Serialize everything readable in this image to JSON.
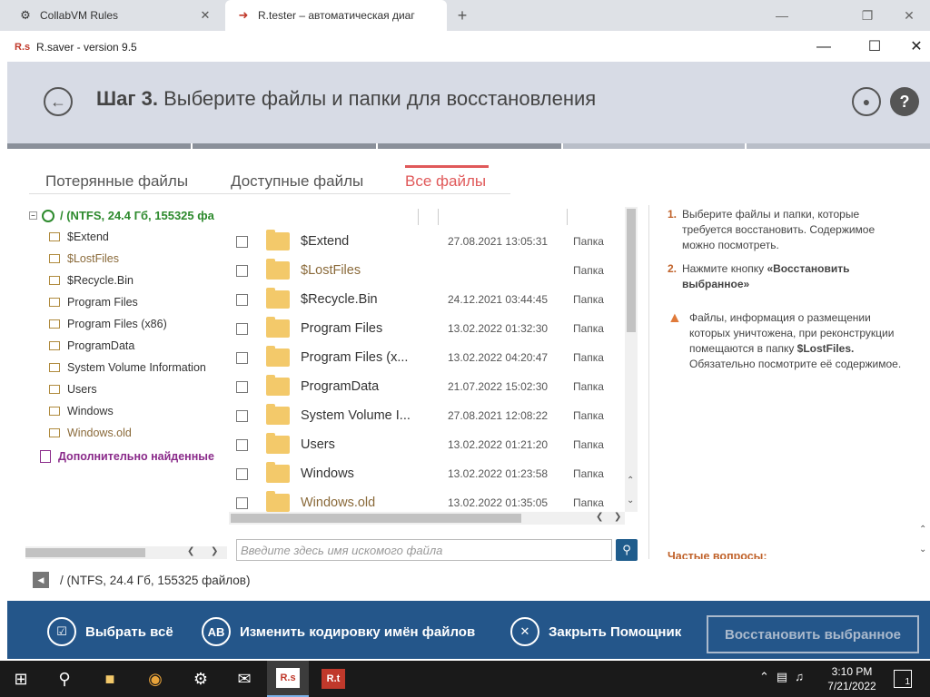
{
  "browser": {
    "tabs": [
      {
        "title": "CollabVM Rules",
        "icon": "collabvm-icon"
      },
      {
        "title": "R.tester – автоматическая диаг",
        "icon": "rtester-icon"
      }
    ]
  },
  "app": {
    "logo": "R.s",
    "title": "R.saver - version 9.5"
  },
  "header": {
    "step_label": "Шаг 3.",
    "step_text": "Выберите файлы и папки для восстановления"
  },
  "view_tabs": [
    {
      "label": "Потерянные файлы",
      "active": false
    },
    {
      "label": "Доступные файлы",
      "active": false
    },
    {
      "label": "Все файлы",
      "active": true
    }
  ],
  "tree": {
    "root": "/ (NTFS, 24.4 Гб, 155325 фа",
    "nodes": [
      "$Extend",
      "$LostFiles",
      "$Recycle.Bin",
      "Program Files",
      "Program Files (x86)",
      "ProgramData",
      "System Volume Information",
      "Users",
      "Windows",
      "Windows.old"
    ],
    "extra": "Дополнительно найденные"
  },
  "files": [
    {
      "name": "$Extend",
      "date": "27.08.2021 13:05:31",
      "type": "Папка"
    },
    {
      "name": "$LostFiles",
      "date": "",
      "type": "Папка"
    },
    {
      "name": "$Recycle.Bin",
      "date": "24.12.2021 03:44:45",
      "type": "Папка"
    },
    {
      "name": "Program Files",
      "date": "13.02.2022 01:32:30",
      "type": "Папка"
    },
    {
      "name": "Program Files (x...",
      "date": "13.02.2022 04:20:47",
      "type": "Папка"
    },
    {
      "name": "ProgramData",
      "date": "21.07.2022 15:02:30",
      "type": "Папка"
    },
    {
      "name": "System Volume I...",
      "date": "27.08.2021 12:08:22",
      "type": "Папка"
    },
    {
      "name": "Users",
      "date": "13.02.2022 01:21:20",
      "type": "Папка"
    },
    {
      "name": "Windows",
      "date": "13.02.2022 01:23:58",
      "type": "Папка"
    },
    {
      "name": "Windows.old",
      "date": "13.02.2022 01:35:05",
      "type": "Папка"
    }
  ],
  "search": {
    "placeholder": "Введите здесь имя искомого файла"
  },
  "help": {
    "item1_num": "1.",
    "item1_text": "Выберите файлы и папки, которые требуется восстановить. Содержимое можно посмотреть.",
    "item2_num": "2.",
    "item2_text_pre": "Нажмите кнопку ",
    "item2_text_bold": "«Восстановить выбранное»",
    "warning_pre": "Файлы, информация о размещении которых уничтожена, при реконструкции помещаются в папку ",
    "warning_bold": "$LostFiles.",
    "warning_post": " Обязательно посмотрите её содержимое.",
    "faq": "Частые вопросы:"
  },
  "path": "/ (NTFS, 24.4 Гб, 155325 файлов)",
  "actions": {
    "select_all": "Выбрать всё",
    "encoding": "Изменить кодировку имён файлов",
    "encoding_icon_text": "AB",
    "close_helper": "Закрыть Помощник",
    "restore": "Восстановить выбранное"
  },
  "taskbar": {
    "time": "3:10 PM",
    "date": "7/21/2022",
    "notif_count": "1",
    "rs_label": "R.s",
    "rt_label": "R.t"
  }
}
